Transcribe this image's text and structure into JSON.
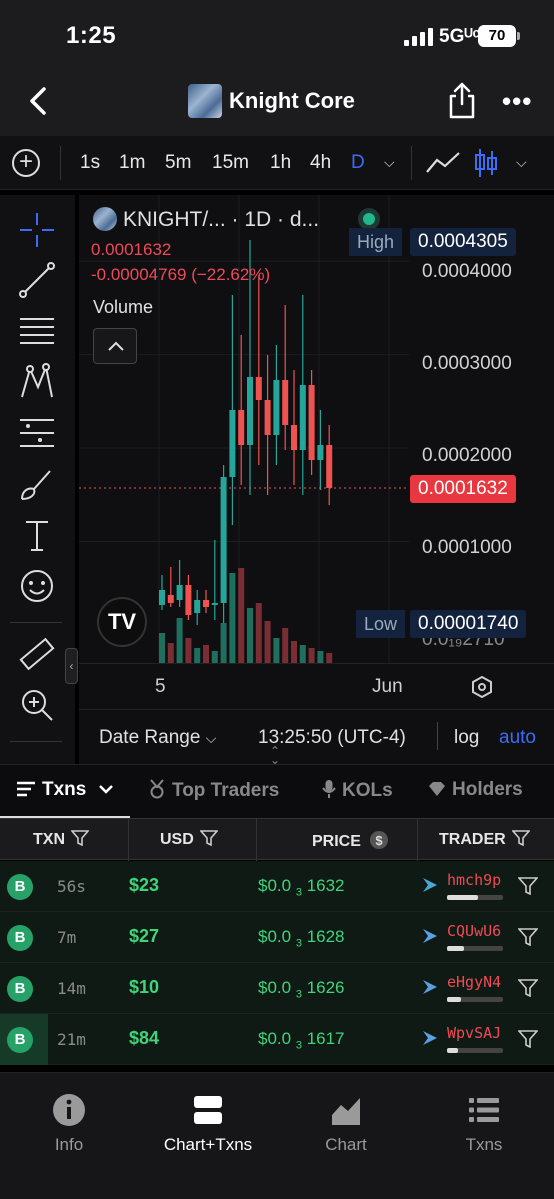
{
  "status": {
    "time": "1:25",
    "network": "5Gᵁᶜ",
    "battery": "70"
  },
  "header": {
    "title": "Knight Core"
  },
  "toolbar": {
    "timeframes": [
      "1s",
      "1m",
      "5m",
      "15m",
      "1h",
      "4h",
      "D"
    ],
    "active_timeframe": "D"
  },
  "chart": {
    "legend_title": "KNIGHT/... · 1D · d...",
    "legend_price": "0.0001632",
    "legend_change": "-0.00004769 (−22.62%)",
    "volume_label": "Volume",
    "y_labels": [
      "0.0004000",
      "0.0003000",
      "0.0002000",
      "0.0001000",
      "0.0₁₉2710"
    ],
    "high_label": "High",
    "high_value": "0.0004305",
    "low_label": "Low",
    "low_value": "0.00001740",
    "current_value": "0.0001632",
    "x_labels": [
      "5",
      "Jun"
    ],
    "date_range": "Date Range",
    "clock": "13:25:50 (UTC-4)",
    "log": "log",
    "auto": "auto",
    "colors": {
      "up": "#26a69a",
      "down": "#ef5350",
      "accent": "#3b6cf6"
    }
  },
  "chart_data": {
    "type": "candlestick",
    "ylim": [
      1.74e-05,
      0.0004305
    ],
    "candles_note_visible": "daily candles",
    "high": 0.0004305,
    "low": 1.74e-05,
    "last": 0.0001632
  },
  "tabs": [
    "Txns",
    "Top Traders",
    "KOLs",
    "Holders"
  ],
  "table": {
    "headers": [
      "TXN",
      "USD",
      "PRICE",
      "TRADER"
    ],
    "rows": [
      {
        "type": "B",
        "age": "56s",
        "usd": "$23",
        "price_prefix": "$0.0",
        "price_zeros": "3",
        "price_digits": "1632",
        "trader": "hmch9p",
        "bar": 0.55
      },
      {
        "type": "B",
        "age": "7m",
        "usd": "$27",
        "price_prefix": "$0.0",
        "price_zeros": "3",
        "price_digits": "1628",
        "trader": "CQUwU6",
        "bar": 0.3
      },
      {
        "type": "B",
        "age": "14m",
        "usd": "$10",
        "price_prefix": "$0.0",
        "price_zeros": "3",
        "price_digits": "1626",
        "trader": "eHgyN4",
        "bar": 0.25
      },
      {
        "type": "B",
        "age": "21m",
        "usd": "$84",
        "price_prefix": "$0.0",
        "price_zeros": "3",
        "price_digits": "1617",
        "trader": "WpvSAJ",
        "bar": 0.2
      }
    ]
  },
  "nav": [
    "Info",
    "Chart+Txns",
    "Chart",
    "Txns"
  ]
}
